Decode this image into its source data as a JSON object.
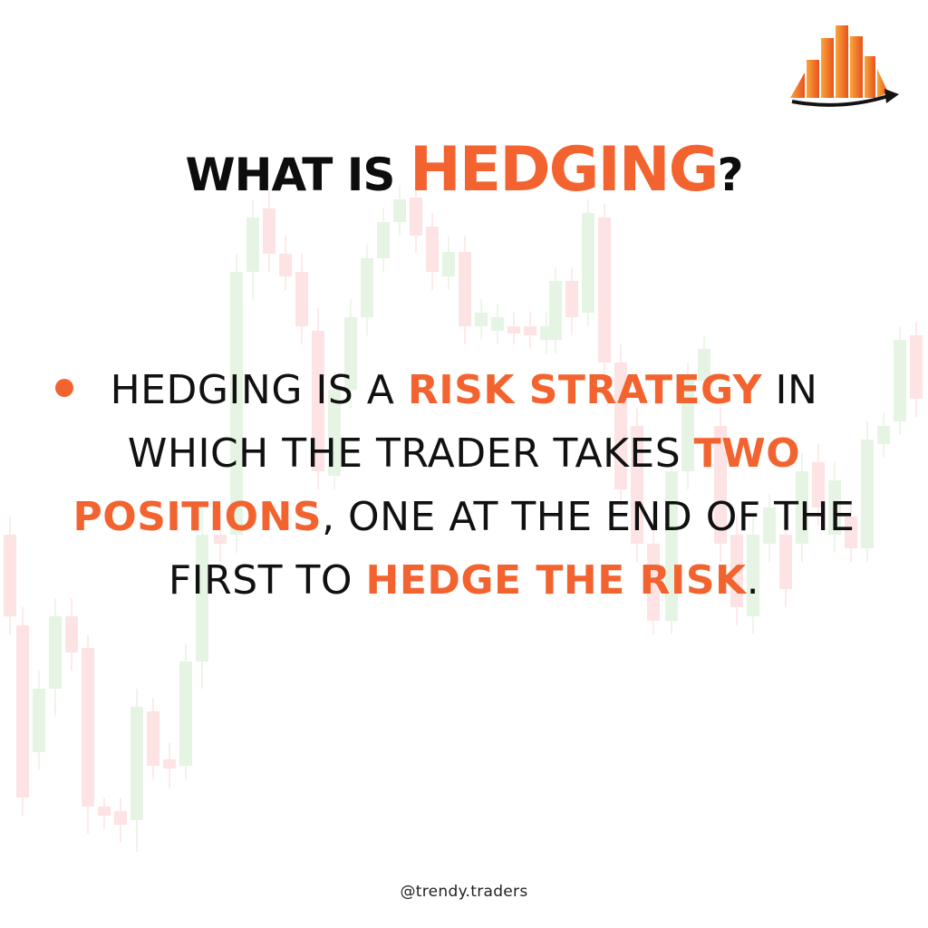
{
  "title": {
    "prefix": "WHAT IS ",
    "highlight": "HEDGING",
    "suffix": "?"
  },
  "bullet": {
    "segments": [
      {
        "text": "HEDGING IS A ",
        "accent": false
      },
      {
        "text": "RISK STRATEGY",
        "accent": true
      },
      {
        "text": " IN WHICH THE TRADER TAKES ",
        "accent": false
      },
      {
        "text": "TWO POSITIONS",
        "accent": true
      },
      {
        "text": ", ONE AT THE END OF THE FIRST TO ",
        "accent": false
      },
      {
        "text": "HEDGE THE RISK",
        "accent": true
      },
      {
        "text": ".",
        "accent": false
      }
    ]
  },
  "handle": "@trendy.traders",
  "colors": {
    "accent": "#f2632f",
    "text": "#0d0d0d",
    "candle_up": "#e6f4e3",
    "candle_down": "#fde3e3",
    "background": "#ffffff"
  },
  "icons": {
    "logo": "orange-bar-chart-logo-icon",
    "bullet": "orange-dot-bullet-icon"
  }
}
